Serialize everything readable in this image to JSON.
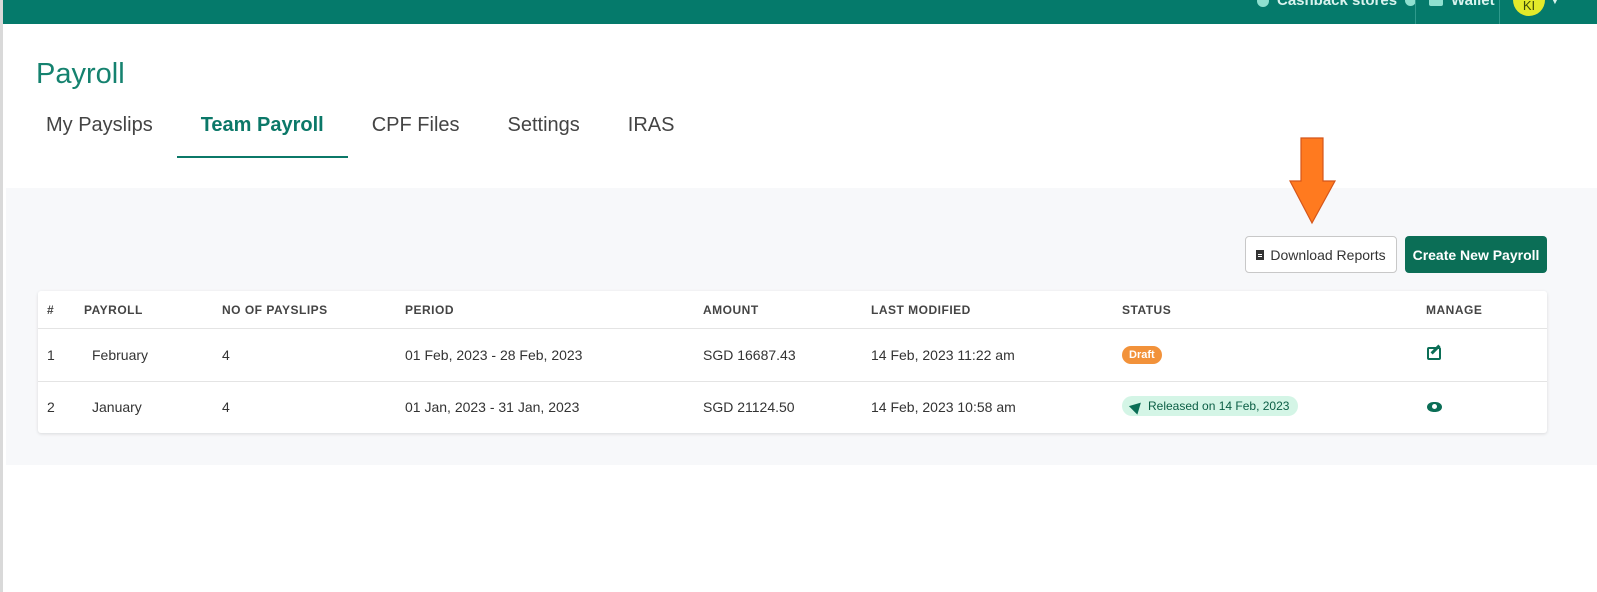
{
  "topbar": {
    "cashback_label": "Cashback stores",
    "wallet_label": "Wallet",
    "avatar_initials": "KI"
  },
  "page": {
    "title": "Payroll"
  },
  "tabs": [
    {
      "label": "My Payslips"
    },
    {
      "label": "Team Payroll"
    },
    {
      "label": "CPF Files"
    },
    {
      "label": "Settings"
    },
    {
      "label": "IRAS"
    }
  ],
  "actions": {
    "download_label": "Download Reports",
    "create_label": "Create New Payroll"
  },
  "table": {
    "headers": [
      "#",
      "PAYROLL",
      "NO OF PAYSLIPS",
      "PERIOD",
      "AMOUNT",
      "LAST MODIFIED",
      "STATUS",
      "MANAGE"
    ],
    "rows": [
      {
        "index": "1",
        "payroll": "February",
        "payslips": "4",
        "period": "01 Feb, 2023 - 28 Feb, 2023",
        "amount": "SGD 16687.43",
        "modified": "14 Feb, 2023 11:22 am",
        "status": "Draft",
        "manage_icon": "edit-icon"
      },
      {
        "index": "2",
        "payroll": "January",
        "payslips": "4",
        "period": "01 Jan, 2023 - 31 Jan, 2023",
        "amount": "SGD 21124.50",
        "modified": "14 Feb, 2023 10:58 am",
        "status": "Released on 14 Feb, 2023",
        "manage_icon": "eye-icon"
      }
    ]
  },
  "colors": {
    "brand": "#057a6b",
    "primary_button": "#0b6e56",
    "draft_badge": "#f2923a",
    "released_badge": "#d4f5e6",
    "annotation_arrow": "#ff7a1f"
  }
}
